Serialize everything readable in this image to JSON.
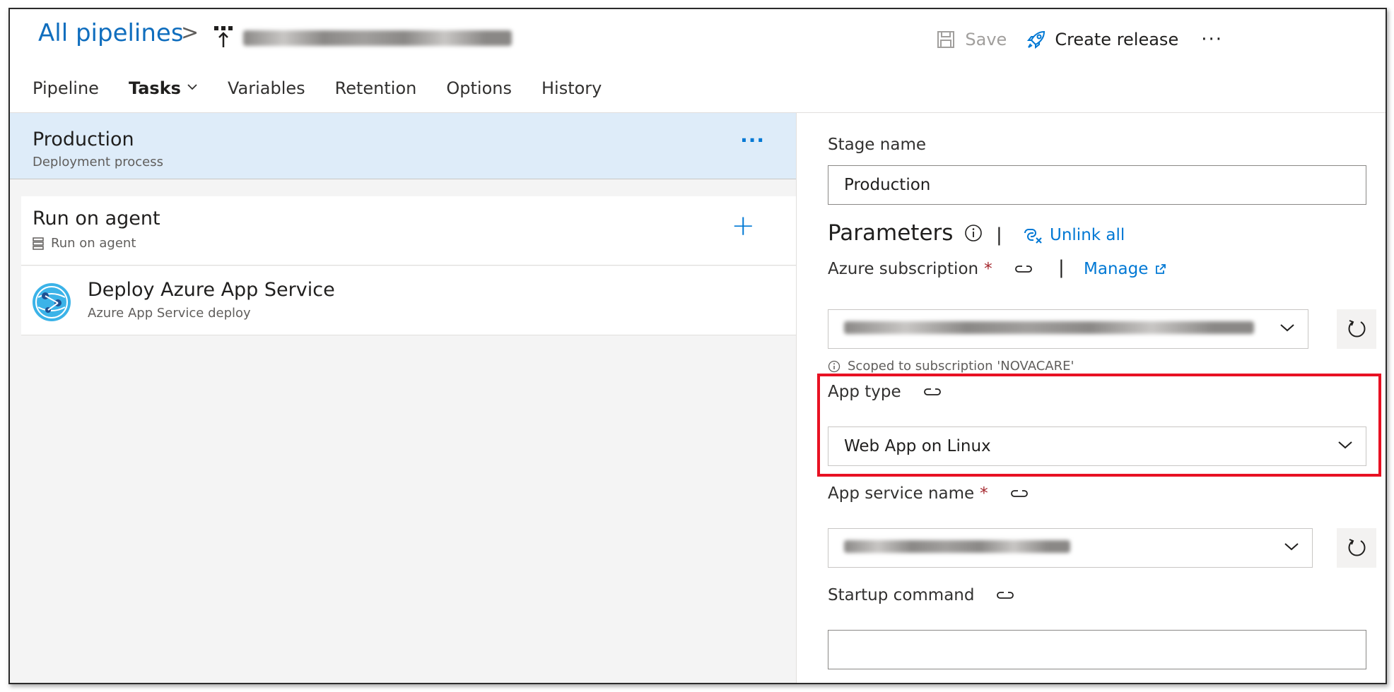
{
  "breadcrumb": {
    "root": "All pipelines",
    "separator": ">"
  },
  "toolbar": {
    "save_label": "Save",
    "create_release_label": "Create release",
    "more_label": "···"
  },
  "tabs": [
    {
      "label": "Pipeline"
    },
    {
      "label": "Tasks"
    },
    {
      "label": "Variables"
    },
    {
      "label": "Retention"
    },
    {
      "label": "Options"
    },
    {
      "label": "History"
    }
  ],
  "stage": {
    "title": "Production",
    "subtitle": "Deployment process",
    "more_label": "···"
  },
  "job": {
    "title": "Run on agent",
    "subtitle": "Run on agent",
    "add_label": "+"
  },
  "task": {
    "title": "Deploy Azure App Service",
    "subtitle": "Azure App Service deploy"
  },
  "form": {
    "stage_name_label": "Stage name",
    "stage_name_value": "Production",
    "parameters_title": "Parameters",
    "separator": "|",
    "unlink_all_label": "Unlink all",
    "azure_subscription_label": "Azure subscription",
    "required_mark": "*",
    "manage_label": "Manage",
    "scoped_note": "Scoped to subscription 'NOVACARE'",
    "app_type_label": "App type",
    "app_type_value": "Web App on Linux",
    "app_service_name_label": "App service name",
    "startup_command_label": "Startup command",
    "startup_command_value": ""
  },
  "colors": {
    "accent": "#0078d4",
    "link": "#106ebe",
    "selected_stage_bg": "#deecf9",
    "highlight_border": "#e81123",
    "required": "#a4262c"
  }
}
